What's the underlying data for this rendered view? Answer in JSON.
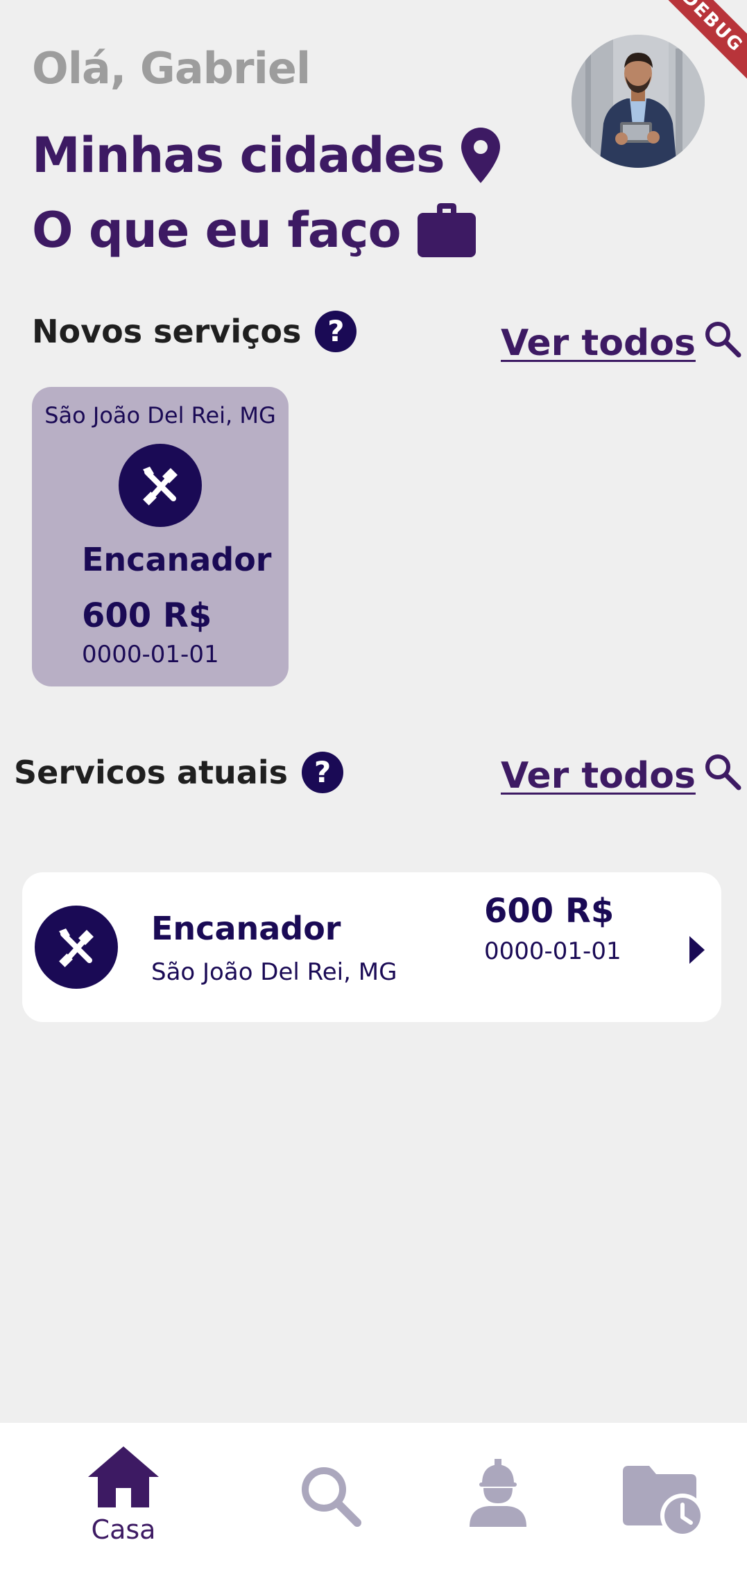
{
  "debug_banner": "DEBUG",
  "header": {
    "greeting": "Olá, Gabriel",
    "my_cities": "Minhas cidades",
    "what_i_do": "O que eu faço",
    "icons": [
      "location-pin-icon",
      "briefcase-icon"
    ]
  },
  "new_services": {
    "title": "Novos serviços",
    "see_all": "Ver todos",
    "cards": [
      {
        "city": "São João Del Rei, MG",
        "title": "Encanador",
        "price": "600 R$",
        "date": "0000-01-01",
        "icon": "tools-icon"
      }
    ]
  },
  "current_services": {
    "title": "Servicos atuais",
    "see_all": "Ver todos",
    "items": [
      {
        "title": "Encanador",
        "city": "São João Del Rei, MG",
        "price": "600 R$",
        "date": "0000-01-01",
        "icon": "tools-icon"
      }
    ]
  },
  "bottom_nav": {
    "items": [
      {
        "label": "Casa",
        "icon": "home-icon",
        "active": true
      },
      {
        "label": "",
        "icon": "search-icon",
        "active": false
      },
      {
        "label": "",
        "icon": "worker-icon",
        "active": false
      },
      {
        "label": "",
        "icon": "folder-clock-icon",
        "active": false
      }
    ]
  },
  "colors": {
    "background": "#efefef",
    "primary": "#3d1a63",
    "dark_navy": "#1a0a55",
    "greeting_gray": "#9d9d9d",
    "new_card_bg": "#b8afc5",
    "nav_inactive": "#aba7bd",
    "debug_red": "#b8343a"
  }
}
